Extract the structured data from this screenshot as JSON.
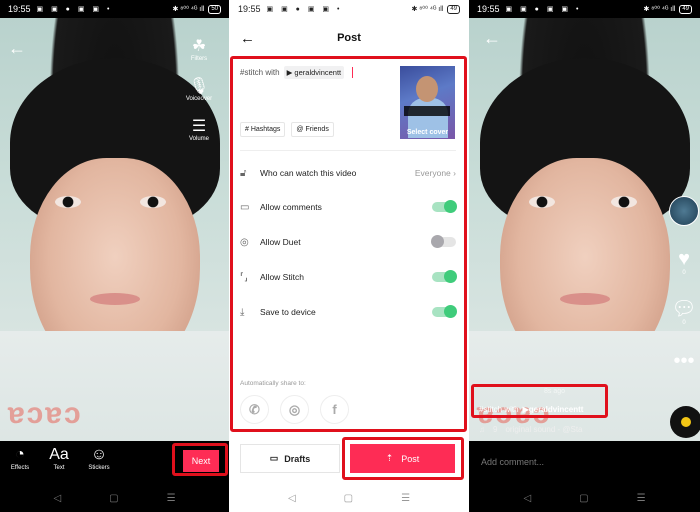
{
  "status_bar": {
    "time": "19:55",
    "notification_icons": "▣ ▣ ● ▣ ▣ •",
    "right": "✱ ⁸⁰⁰ ⁴ᴳ ıll",
    "battery_p1": "50",
    "battery_p2": "49",
    "battery_p3": "49"
  },
  "editor": {
    "side_tools": [
      {
        "icon": "filters-icon",
        "glyph": "☘",
        "label": "Filters"
      },
      {
        "icon": "microphone-icon",
        "glyph": "🎙",
        "label": "Voiceover"
      },
      {
        "icon": "volume-sliders-icon",
        "glyph": "☰",
        "label": "Volume"
      }
    ],
    "bottom_tools": [
      {
        "icon": "effects-icon",
        "glyph": "◔",
        "label": "Effects"
      },
      {
        "icon": "text-icon",
        "glyph": "Aa",
        "label": "Text"
      },
      {
        "icon": "stickers-icon",
        "glyph": "☺",
        "label": "Stickers"
      }
    ],
    "next_label": "Next",
    "overlay_text": "ɐɔɐɔ"
  },
  "post": {
    "title": "Post",
    "caption_text": "#stitch with",
    "mention": "▶ geraldvincentt",
    "select_cover": "Select cover",
    "chips": [
      "# Hashtags",
      "@ Friends"
    ],
    "who_can_watch": {
      "label": "Who can watch this video",
      "value": "Everyone"
    },
    "toggles": [
      {
        "label": "Allow comments",
        "icon": "comment-icon",
        "glyph": "▭",
        "on": true
      },
      {
        "label": "Allow Duet",
        "icon": "duet-icon",
        "glyph": "◎",
        "on": false
      },
      {
        "label": "Allow Stitch",
        "icon": "stitch-icon",
        "glyph": "⸢⸥",
        "on": true
      },
      {
        "label": "Save to device",
        "icon": "download-icon",
        "glyph": "⤓",
        "on": true
      }
    ],
    "share_label": "Automatically share to:",
    "share_targets": [
      {
        "name": "whatsapp",
        "glyph": "✆"
      },
      {
        "name": "instagram",
        "glyph": "◎"
      },
      {
        "name": "facebook",
        "glyph": "f"
      }
    ],
    "drafts_label": "Drafts",
    "post_label": "Post"
  },
  "viewer": {
    "ago": "8s ago",
    "caption_text": "#stitch  with",
    "mention": "▶geraldvincentt",
    "like_count": "0",
    "comment_count": "0",
    "sound_count": "9",
    "sound_name": "original sound - @Sta",
    "comment_placeholder": "Add comment..."
  },
  "nav": {
    "back": "◁",
    "home": "▢",
    "menu": "☰"
  }
}
